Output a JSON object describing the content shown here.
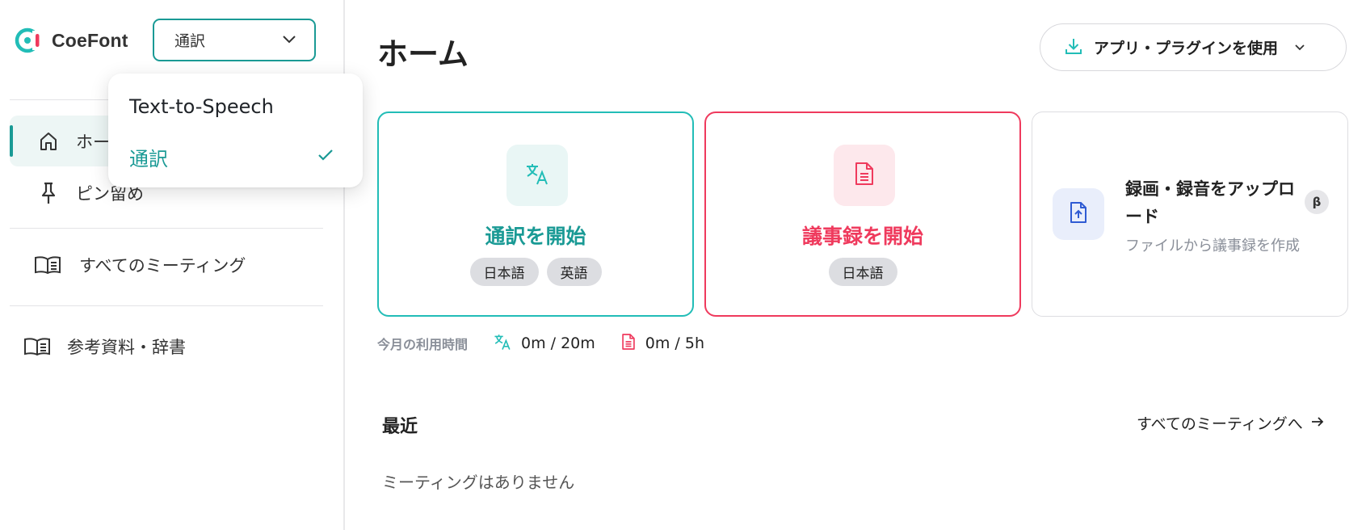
{
  "brand": {
    "name": "CoeFont"
  },
  "mode_select": {
    "value": "通訳"
  },
  "dropdown": {
    "options": [
      {
        "label": "Text-to-Speech",
        "selected": false
      },
      {
        "label": "通訳",
        "selected": true
      }
    ]
  },
  "sidebar": {
    "items": [
      {
        "label": "ホーム",
        "icon": "home-icon",
        "active": true
      },
      {
        "label": "ピン留め",
        "icon": "pin-icon",
        "active": false
      },
      {
        "label": "すべてのミーティング",
        "icon": "book-icon",
        "active": false
      },
      {
        "label": "参考資料・辞書",
        "icon": "book-icon",
        "active": false
      }
    ]
  },
  "header": {
    "title": "ホーム",
    "apps_button_label": "アプリ・プラグインを使用"
  },
  "cards": {
    "translate": {
      "title": "通訳を開始",
      "tags": [
        "日本語",
        "英語"
      ],
      "icon": "translate-icon"
    },
    "minutes": {
      "title": "議事録を開始",
      "tags": [
        "日本語"
      ],
      "icon": "document-icon"
    },
    "upload": {
      "title": "録画・録音をアップロード",
      "subtitle": "ファイルから議事録を作成",
      "badge": "β",
      "icon": "file-upload-icon"
    }
  },
  "usage": {
    "label": "今月の利用時間",
    "translate_value": "0m / 20m",
    "minutes_value": "0m / 5h"
  },
  "recent": {
    "title": "最近",
    "all_link_label": "すべてのミーティングへ",
    "empty_text": "ミーティングはありません"
  },
  "colors": {
    "accent_teal": "#1a9a95",
    "translate_border": "#22bdb7",
    "minutes_red": "#ef3a5d",
    "upload_blue": "#2f5bd3"
  }
}
